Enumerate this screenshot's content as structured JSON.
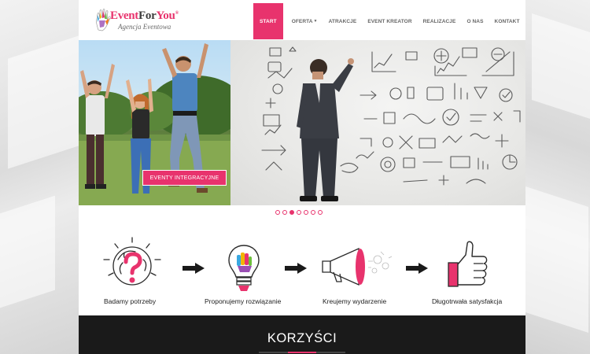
{
  "brand": {
    "name_part1": "Event",
    "name_part2": "For",
    "name_part3": "You",
    "registered": "®",
    "tagline": "Agencja Eventowa",
    "accent_color": "#e8336d"
  },
  "nav": {
    "items": [
      {
        "label": "START",
        "active": true
      },
      {
        "label": "OFERTA",
        "has_dropdown": true
      },
      {
        "label": "ATRAKCJE"
      },
      {
        "label": "EVENT KREATOR"
      },
      {
        "label": "REALIZACJE"
      },
      {
        "label": "O NAS"
      },
      {
        "label": "KONTAKT"
      }
    ]
  },
  "hero": {
    "button_label": "EVENTY INTEGRACYJNE",
    "slides_count": 7,
    "active_slide_index": 2
  },
  "process": {
    "steps": [
      {
        "label": "Badamy potrzeby",
        "icon": "question-bulb-icon"
      },
      {
        "label": "Proponujemy rozwiązanie",
        "icon": "lightbulb-icon"
      },
      {
        "label": "Kreujemy wydarzenie",
        "icon": "megaphone-icon"
      },
      {
        "label": "Długotrwała satysfakcja",
        "icon": "thumbs-up-icon"
      }
    ]
  },
  "benefits": {
    "title": "KORZYŚCI"
  }
}
